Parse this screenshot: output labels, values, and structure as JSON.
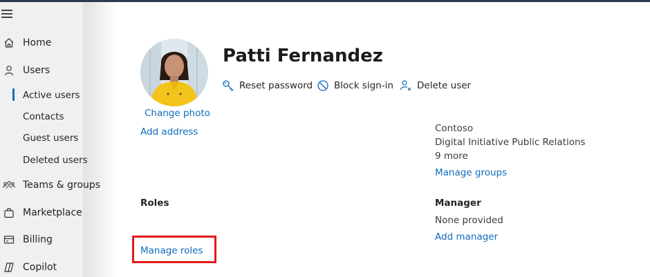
{
  "sidebar": {
    "items": [
      {
        "label": "Home",
        "icon": "home-icon"
      },
      {
        "label": "Users",
        "icon": "person-icon"
      },
      {
        "label": "Teams & groups",
        "icon": "people-team-icon"
      },
      {
        "label": "Marketplace",
        "icon": "shopping-bag-icon"
      },
      {
        "label": "Billing",
        "icon": "credit-card-icon"
      },
      {
        "label": "Copilot",
        "icon": "copilot-icon"
      }
    ],
    "users_sub": [
      "Active users",
      "Contacts",
      "Guest users",
      "Deleted users"
    ],
    "active_sub": "Active users"
  },
  "user": {
    "name": "Patti Fernandez",
    "change_photo": "Change photo",
    "add_address": "Add address"
  },
  "actions": {
    "reset_password": "Reset password",
    "block_signin": "Block sign-in",
    "delete_user": "Delete user"
  },
  "groups": {
    "items": [
      "Contoso",
      "Digital Initiative Public Relations"
    ],
    "more": "9 more",
    "manage": "Manage groups"
  },
  "roles": {
    "heading": "Roles",
    "manage": "Manage roles"
  },
  "manager": {
    "heading": "Manager",
    "value": "None provided",
    "add": "Add manager"
  },
  "colors": {
    "link": "#0f6cbd",
    "highlight": "#e11b1b"
  }
}
